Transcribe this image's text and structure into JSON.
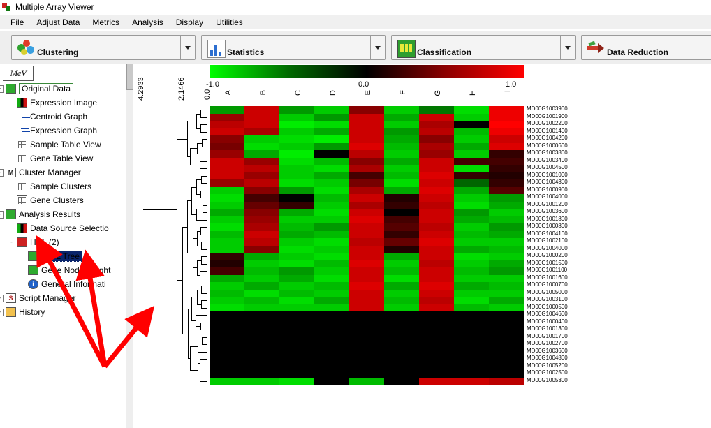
{
  "window": {
    "title": "Multiple Array Viewer",
    "icon": "mev-app-icon"
  },
  "menu": {
    "items": [
      "File",
      "Adjust Data",
      "Metrics",
      "Analysis",
      "Display",
      "Utilities"
    ]
  },
  "toolbar": {
    "groups": [
      {
        "label": "Clustering",
        "icon": "cluster-icon"
      },
      {
        "label": "Statistics",
        "icon": "statistics-icon"
      },
      {
        "label": "Classification",
        "icon": "classification-icon"
      },
      {
        "label": "Data Reduction",
        "icon": "data-reduction-icon"
      }
    ]
  },
  "sidebar": {
    "logo": "MeV",
    "items": [
      {
        "label": "Original Data",
        "icon": "green-square-icon",
        "indent": 1,
        "state": "selected-outline"
      },
      {
        "label": "Expression Image",
        "icon": "expression-image-icon",
        "indent": 2
      },
      {
        "label": "Centroid Graph",
        "icon": "centroid-graph-icon",
        "indent": 2
      },
      {
        "label": "Expression Graph",
        "icon": "expression-graph-icon",
        "indent": 2
      },
      {
        "label": "Sample Table View",
        "icon": "table-icon",
        "indent": 2
      },
      {
        "label": "Gene Table View",
        "icon": "table-icon",
        "indent": 2
      },
      {
        "label": "Cluster Manager",
        "icon": "m-letter-icon",
        "indent": 1
      },
      {
        "label": "Sample Clusters",
        "icon": "table-icon",
        "indent": 2
      },
      {
        "label": "Gene Clusters",
        "icon": "table-icon",
        "indent": 2
      },
      {
        "label": "Analysis Results",
        "icon": "green-square-icon",
        "indent": 1
      },
      {
        "label": "Data Source Selectio",
        "icon": "expression-image-icon",
        "indent": 2
      },
      {
        "label": "HCL (2)",
        "icon": "red-square-icon",
        "indent": 2
      },
      {
        "label": "HCL Tree",
        "icon": "green-square-icon",
        "indent": 3,
        "state": "selected-highlight"
      },
      {
        "label": "Gene Node Height",
        "icon": "green-square-icon",
        "indent": 3
      },
      {
        "label": "General Informati",
        "icon": "info-icon",
        "indent": 3
      },
      {
        "label": "Script Manager",
        "icon": "script-icon",
        "indent": 1
      },
      {
        "label": "History",
        "icon": "history-icon",
        "indent": 1
      }
    ]
  },
  "viewer": {
    "scale": {
      "left_value": "-1.0",
      "mid_value": "0.0",
      "right_value": "1.0",
      "gradient": [
        "#00ff00",
        "#000000",
        "#ff0000"
      ]
    },
    "vertical_labels": [
      "4.2933",
      "2.1466",
      "0.0"
    ],
    "column_labels": [
      "A",
      "B",
      "C",
      "D",
      "E",
      "F",
      "G",
      "H",
      "I"
    ],
    "row_labels": [
      "MD00G1003900",
      "MD00G1001900",
      "MD00G1002200",
      "MD00G1001400",
      "MD00G1004200",
      "MD00G1000600",
      "MD00G1003800",
      "MD00G1003400",
      "MD00G1004500",
      "MD00G1001000",
      "MD00G1004300",
      "MD00G1000900",
      "MD00G1004000",
      "MD00G1001200",
      "MD00G1003600",
      "MD00G1001800",
      "MD00G1000800",
      "MD00G1004100",
      "MD00G1002100",
      "MD00G1004000",
      "MD00G1000200",
      "MD00G1001500",
      "MD00G1001100",
      "MD00G1001600",
      "MD00G1000700",
      "MD00G1005000",
      "MD00G1003100",
      "MD00G1000500",
      "MD00G1004600",
      "MD00G1000400",
      "MD00G1001300",
      "MD00G1001700",
      "MD00G1002700",
      "MD00G1003600",
      "MD00G1004800",
      "MD00G1005200",
      "MD00G1002500",
      "MD00G1005300"
    ]
  },
  "heatmap_data": {
    "type": "heatmap",
    "columns": [
      "A",
      "B",
      "C",
      "D",
      "E",
      "F",
      "G",
      "H",
      "I"
    ],
    "colors": [
      [
        "#009900",
        "#cc0000",
        "#009900",
        "#00cc00",
        "#880000",
        "#00cc00",
        "#007700",
        "#00dd00",
        "#ee0000"
      ],
      [
        "#990000",
        "#cc0000",
        "#00cc00",
        "#009900",
        "#cc0000",
        "#00aa00",
        "#cc0000",
        "#00cc00",
        "#ee0000"
      ],
      [
        "#bb0000",
        "#cc0000",
        "#00ee00",
        "#00dd00",
        "#cc0000",
        "#00cc00",
        "#aa0000",
        "#000000",
        "#ff0000"
      ],
      [
        "#cc0000",
        "#aa0000",
        "#00cc00",
        "#00aa00",
        "#cc0000",
        "#009900",
        "#bb0000",
        "#00bb00",
        "#ee0000"
      ],
      [
        "#880000",
        "#00cc00",
        "#00dd00",
        "#00ee00",
        "#cc0000",
        "#00aa00",
        "#880000",
        "#00cc00",
        "#cc0000"
      ],
      [
        "#770000",
        "#00dd00",
        "#00cc00",
        "#009900",
        "#dd0000",
        "#00bb00",
        "#aa0000",
        "#00aa00",
        "#dd0000"
      ],
      [
        "#990000",
        "#00aa00",
        "#00ee00",
        "#000000",
        "#bb0000",
        "#00cc00",
        "#990000",
        "#00cc00",
        "#330000"
      ],
      [
        "#cc0000",
        "#990000",
        "#00dd00",
        "#00bb00",
        "#880000",
        "#00aa00",
        "#cc0000",
        "#440000",
        "#440000"
      ],
      [
        "#cc0000",
        "#bb0000",
        "#00cc00",
        "#00dd00",
        "#aa0000",
        "#00cc00",
        "#cc0000",
        "#00dd00",
        "#330000"
      ],
      [
        "#cc0000",
        "#990000",
        "#00cc00",
        "#00aa00",
        "#440000",
        "#00bb00",
        "#dd0000",
        "#330000",
        "#220000"
      ],
      [
        "#990000",
        "#bb0000",
        "#00dd00",
        "#00cc00",
        "#770000",
        "#00dd00",
        "#cc0000",
        "#006600",
        "#330000"
      ],
      [
        "#00cc00",
        "#880000",
        "#009900",
        "#00dd00",
        "#aa0000",
        "#00aa00",
        "#dd0000",
        "#00aa00",
        "#550000"
      ],
      [
        "#00dd00",
        "#440000",
        "#000000",
        "#00bb00",
        "#cc0000",
        "#220000",
        "#cc0000",
        "#00cc00",
        "#009900"
      ],
      [
        "#00cc00",
        "#660000",
        "#330000",
        "#00cc00",
        "#aa0000",
        "#330000",
        "#bb0000",
        "#00dd00",
        "#00aa00"
      ],
      [
        "#00aa00",
        "#880000",
        "#00aa00",
        "#00dd00",
        "#cc0000",
        "#000000",
        "#cc0000",
        "#009900",
        "#00cc00"
      ],
      [
        "#00cc00",
        "#990000",
        "#00cc00",
        "#00cc00",
        "#dd0000",
        "#440000",
        "#cc0000",
        "#00aa00",
        "#00bb00"
      ],
      [
        "#00dd00",
        "#aa0000",
        "#00bb00",
        "#009900",
        "#cc0000",
        "#550000",
        "#bb0000",
        "#00cc00",
        "#009900"
      ],
      [
        "#00bb00",
        "#cc0000",
        "#00aa00",
        "#00bb00",
        "#cc0000",
        "#330000",
        "#cc0000",
        "#00bb00",
        "#00aa00"
      ],
      [
        "#00cc00",
        "#bb0000",
        "#00cc00",
        "#00dd00",
        "#bb0000",
        "#660000",
        "#dd0000",
        "#00cc00",
        "#00cc00"
      ],
      [
        "#00cc00",
        "#880000",
        "#00dd00",
        "#00cc00",
        "#cc0000",
        "#220000",
        "#cc0000",
        "#00aa00",
        "#00bb00"
      ],
      [
        "#330000",
        "#00aa00",
        "#00cc00",
        "#00dd00",
        "#cc0000",
        "#00aa00",
        "#cc0000",
        "#00dd00",
        "#00cc00"
      ],
      [
        "#220000",
        "#00cc00",
        "#00dd00",
        "#00bb00",
        "#dd0000",
        "#00cc00",
        "#bb0000",
        "#00cc00",
        "#00aa00"
      ],
      [
        "#440000",
        "#00bb00",
        "#009900",
        "#00cc00",
        "#cc0000",
        "#00bb00",
        "#cc0000",
        "#00bb00",
        "#009900"
      ],
      [
        "#00aa00",
        "#00cc00",
        "#00aa00",
        "#00dd00",
        "#cc0000",
        "#00dd00",
        "#cc0000",
        "#00cc00",
        "#00cc00"
      ],
      [
        "#00cc00",
        "#00aa00",
        "#00cc00",
        "#00bb00",
        "#dd0000",
        "#00aa00",
        "#dd0000",
        "#00aa00",
        "#00bb00"
      ],
      [
        "#00bb00",
        "#00dd00",
        "#00bb00",
        "#00cc00",
        "#cc0000",
        "#00cc00",
        "#cc0000",
        "#00cc00",
        "#00cc00"
      ],
      [
        "#00cc00",
        "#00bb00",
        "#00dd00",
        "#00aa00",
        "#cc0000",
        "#00bb00",
        "#bb0000",
        "#00dd00",
        "#00aa00"
      ],
      [
        "#00dd00",
        "#00cc00",
        "#00cc00",
        "#00cc00",
        "#cc0000",
        "#00cc00",
        "#cc0000",
        "#00bb00",
        "#00cc00"
      ],
      [
        "#000000",
        "#000000",
        "#000000",
        "#000000",
        "#000000",
        "#000000",
        "#000000",
        "#000000",
        "#000000"
      ],
      [
        "#000000",
        "#000000",
        "#000000",
        "#000000",
        "#000000",
        "#000000",
        "#000000",
        "#000000",
        "#000000"
      ],
      [
        "#000000",
        "#000000",
        "#000000",
        "#000000",
        "#000000",
        "#000000",
        "#000000",
        "#000000",
        "#000000"
      ],
      [
        "#000000",
        "#000000",
        "#000000",
        "#000000",
        "#000000",
        "#000000",
        "#000000",
        "#000000",
        "#000000"
      ],
      [
        "#000000",
        "#000000",
        "#000000",
        "#000000",
        "#000000",
        "#000000",
        "#000000",
        "#000000",
        "#000000"
      ],
      [
        "#000000",
        "#000000",
        "#000000",
        "#000000",
        "#000000",
        "#000000",
        "#000000",
        "#000000",
        "#000000"
      ],
      [
        "#000000",
        "#000000",
        "#000000",
        "#000000",
        "#000000",
        "#000000",
        "#000000",
        "#000000",
        "#000000"
      ],
      [
        "#000000",
        "#000000",
        "#000000",
        "#000000",
        "#000000",
        "#000000",
        "#000000",
        "#000000",
        "#000000"
      ],
      [
        "#000000",
        "#000000",
        "#000000",
        "#000000",
        "#000000",
        "#000000",
        "#000000",
        "#000000",
        "#000000"
      ],
      [
        "#00cc00",
        "#00cc00",
        "#00dd00",
        "#000000",
        "#00bb00",
        "#000000",
        "#cc0000",
        "#cc0000",
        "#bb0000"
      ]
    ]
  },
  "annotations": {
    "arrow_color": "#ff0000",
    "arrows": 3
  }
}
